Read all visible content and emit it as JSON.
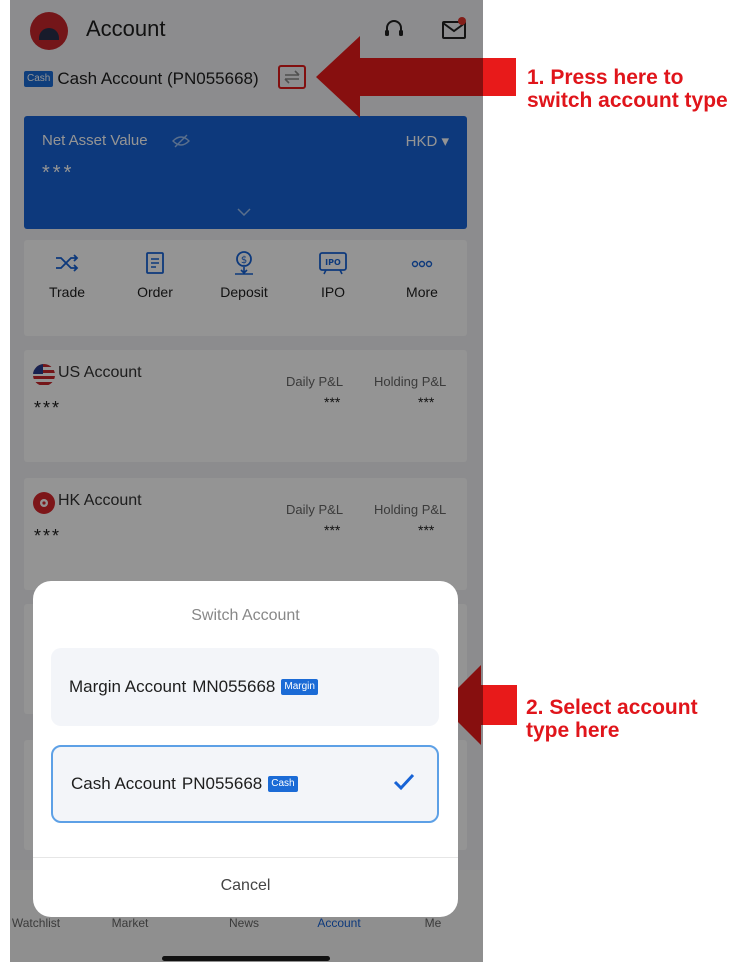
{
  "header": {
    "title": "Account",
    "headset_icon": "headset-icon",
    "mail_icon": "mail-icon"
  },
  "account": {
    "badge": "Cash",
    "name": "Cash Account (PN055668)",
    "switch_icon": "switch-arrows-icon"
  },
  "net_asset": {
    "label": "Net Asset Value",
    "currency": "HKD ▾",
    "value": "***"
  },
  "quick_actions": [
    {
      "label": "Trade",
      "icon": "shuffle-icon"
    },
    {
      "label": "Order",
      "icon": "order-list-icon"
    },
    {
      "label": "Deposit",
      "icon": "deposit-icon"
    },
    {
      "label": "IPO",
      "icon": "ipo-icon"
    },
    {
      "label": "More",
      "icon": "more-dots-icon"
    }
  ],
  "sub_accounts": [
    {
      "name": "US Account",
      "value": "***",
      "daily_label": "Daily P&L",
      "daily_value": "***",
      "holding_label": "Holding P&L",
      "holding_value": "***"
    },
    {
      "name": "HK Account",
      "value": "***",
      "daily_label": "Daily P&L",
      "daily_value": "***",
      "holding_label": "Holding P&L",
      "holding_value": "***"
    }
  ],
  "sheet": {
    "title": "Switch Account",
    "options": [
      {
        "name": "Margin Account",
        "id": "MN055668",
        "badge": "Margin",
        "selected": false
      },
      {
        "name": "Cash Account",
        "id": "PN055668",
        "badge": "Cash",
        "selected": true
      }
    ],
    "cancel": "Cancel"
  },
  "tabs": [
    "Watchlist",
    "Market",
    "News",
    "Account",
    "Me"
  ],
  "annotations": {
    "step1_line1": "1. Press here to",
    "step1_line2": "switch account type",
    "step2_line1": "2. Select account",
    "step2_line2": "type here"
  },
  "colors": {
    "accent": "#1763d6",
    "annotation": "#e0151b",
    "highlight_border": "#e01a1a"
  }
}
